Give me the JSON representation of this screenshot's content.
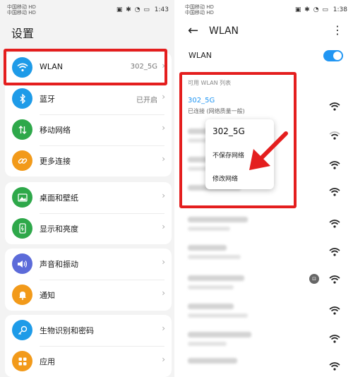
{
  "left": {
    "status_bar": {
      "carrier1": "中国移动 HD",
      "carrier2": "中国移动 HD",
      "speed": "3.2 K/s",
      "time": "1:43"
    },
    "title": "设置",
    "groups": [
      {
        "items": [
          {
            "label": "WLAN",
            "value": "302_5G",
            "icon": "wifi-icon",
            "color": "#1e9be8"
          },
          {
            "label": "蓝牙",
            "value": "已开启",
            "icon": "bluetooth-icon",
            "color": "#1e9be8"
          },
          {
            "label": "移动网络",
            "value": "",
            "icon": "mobile-data-icon",
            "color": "#2ea84a"
          },
          {
            "label": "更多连接",
            "value": "",
            "icon": "link-icon",
            "color": "#f29a1a"
          }
        ]
      },
      {
        "items": [
          {
            "label": "桌面和壁纸",
            "value": "",
            "icon": "wallpaper-icon",
            "color": "#2ea84a"
          },
          {
            "label": "显示和亮度",
            "value": "",
            "icon": "display-icon",
            "color": "#2ea84a"
          }
        ]
      },
      {
        "items": [
          {
            "label": "声音和振动",
            "value": "",
            "icon": "sound-icon",
            "color": "#5c6bd9"
          },
          {
            "label": "通知",
            "value": "",
            "icon": "bell-icon",
            "color": "#f29a1a"
          }
        ]
      },
      {
        "items": [
          {
            "label": "生物识别和密码",
            "value": "",
            "icon": "key-icon",
            "color": "#1e9be8"
          },
          {
            "label": "应用",
            "value": "",
            "icon": "apps-icon",
            "color": "#f29a1a"
          }
        ]
      }
    ]
  },
  "right": {
    "status_bar": {
      "carrier1": "中国移动 HD",
      "carrier2": "中国移动 HD",
      "speed": "48 K/s",
      "time": "1:38"
    },
    "title": "WLAN",
    "toggle_label": "WLAN",
    "toggle_on": true,
    "list_header": "可用 WLAN 列表",
    "connected_network": {
      "name": "302_5G",
      "status": "已连接 (网络质量一般)"
    },
    "popup": {
      "title": "302_5G",
      "items": [
        "不保存网络",
        "修改网络"
      ]
    }
  }
}
